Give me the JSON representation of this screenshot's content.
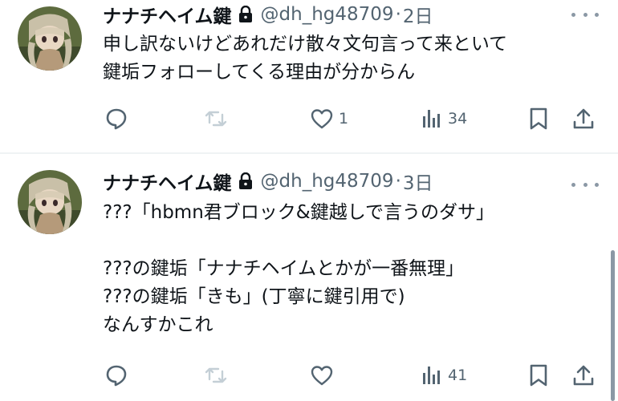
{
  "tweets": [
    {
      "author": {
        "name": "ナナチヘイム鍵",
        "handle": "@dh_hg48709",
        "protected_icon": "lock-icon",
        "avatar_icon": "anime-character-avatar"
      },
      "separator": "·",
      "time": "2日",
      "text_lines": [
        "申し訳ないけどあれだけ散々文句言って来といて",
        "鍵垢フォローしてくる理由が分からん"
      ],
      "actions": {
        "reply": {
          "icon": "reply-icon",
          "count": ""
        },
        "retweet": {
          "icon": "retweet-icon",
          "count": ""
        },
        "like": {
          "icon": "heart-icon",
          "count": "1"
        },
        "views": {
          "icon": "views-icon",
          "count": "34"
        },
        "bookmark": {
          "icon": "bookmark-icon"
        },
        "share": {
          "icon": "share-icon"
        }
      }
    },
    {
      "author": {
        "name": "ナナチヘイム鍵",
        "handle": "@dh_hg48709",
        "protected_icon": "lock-icon",
        "avatar_icon": "anime-character-avatar"
      },
      "separator": "·",
      "time": "3日",
      "text_lines": [
        "???「hbmn君ブロック&鍵越しで言うのダサ」",
        "",
        "???の鍵垢「ナナチヘイムとかが一番無理」",
        "???の鍵垢「きも」(丁寧に鍵引用で)",
        "なんすかこれ"
      ],
      "actions": {
        "reply": {
          "icon": "reply-icon",
          "count": ""
        },
        "retweet": {
          "icon": "retweet-icon",
          "count": ""
        },
        "like": {
          "icon": "heart-icon",
          "count": ""
        },
        "views": {
          "icon": "views-icon",
          "count": "41"
        },
        "bookmark": {
          "icon": "bookmark-icon"
        },
        "share": {
          "icon": "share-icon"
        }
      }
    }
  ],
  "colors": {
    "text": "#0f1419",
    "secondary": "#536471",
    "icon": "#536471",
    "retweet_muted": "#c4cfd6",
    "divider": "#eff3f4",
    "background": "#ffffff"
  }
}
